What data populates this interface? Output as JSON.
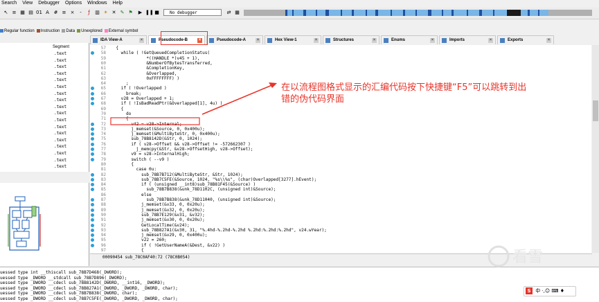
{
  "menu": [
    "Search",
    "View",
    "Debugger",
    "Options",
    "Windows",
    "Help"
  ],
  "toolbar": {
    "debugger_select": "No debugger"
  },
  "legend": [
    {
      "label": "Regular function",
      "color": "#3e7fcf"
    },
    {
      "label": "Instruction",
      "color": "#a0522d"
    },
    {
      "label": "Data",
      "color": "#a0a0a0"
    },
    {
      "label": "Unexplored",
      "color": "#7a9a3a"
    },
    {
      "label": "External symbol",
      "color": "#ff80c0"
    }
  ],
  "tabs": [
    "IDA View-A",
    "Pseudocode-B",
    "Pseudocode-A",
    "Hex View-1",
    "Structures",
    "Enums",
    "Imports",
    "Exports"
  ],
  "functions": {
    "segment_header": "Segment",
    "segments": [
      ".text",
      ".text",
      ".text",
      ".text",
      ".text",
      ".text",
      ".text",
      ".text",
      ".text",
      ".text",
      ".text",
      ".text",
      ".text",
      ".text",
      ".text",
      ".text",
      ".text",
      ".text"
    ]
  },
  "pseudocode": {
    "lines": [
      {
        "n": "57",
        "bp": false,
        "text": "  {"
      },
      {
        "n": "58",
        "bp": true,
        "text": "    while ( !GetQueuedCompletionStatus("
      },
      {
        "n": "59",
        "bp": false,
        "text": "              *((HANDLE *)v45 + 1),"
      },
      {
        "n": "60",
        "bp": false,
        "text": "              &NumberOfBytesTransferred,"
      },
      {
        "n": "61",
        "bp": false,
        "text": "              &CompletionKey,"
      },
      {
        "n": "62",
        "bp": false,
        "text": "              &Overlapped,"
      },
      {
        "n": "63",
        "bp": false,
        "text": "              0xFFFFFFFF) )"
      },
      {
        "n": "64",
        "bp": false,
        "text": "      ;"
      },
      {
        "n": "65",
        "bp": true,
        "text": "    if ( !Overlapped )"
      },
      {
        "n": "66",
        "bp": true,
        "text": "      break;"
      },
      {
        "n": "67",
        "bp": true,
        "text": "    v28 = Overlapped + 1;"
      },
      {
        "n": "68",
        "bp": true,
        "text": "    if ( !IsBadReadPtr(&Overlapped[1], 4u) )"
      },
      {
        "n": "69",
        "bp": false,
        "text": "    {"
      },
      {
        "n": "70",
        "bp": false,
        "text": "      do"
      },
      {
        "n": "71",
        "bp": false,
        "text": "      {"
      },
      {
        "n": "72",
        "bp": true,
        "text": "        v42 = v28->Internal;"
      },
      {
        "n": "73",
        "bp": true,
        "text": "        j_memset(&Source, 0, 0x400u);"
      },
      {
        "n": "74",
        "bp": true,
        "text": "        j_memset(&MultiByteStr, 0, 0x400u);"
      },
      {
        "n": "75",
        "bp": true,
        "text": "        sub_78B8142D(&Str, 0, 1024);"
      },
      {
        "n": "76",
        "bp": true,
        "text": "        if ( v28->Offset && v28->Offset != -572662307 )"
      },
      {
        "n": "77",
        "bp": true,
        "text": "          j_memcpy(&Str, &v28->OffsetHigh, v28->Offset);"
      },
      {
        "n": "78",
        "bp": true,
        "text": "        v9 = v28->InternalHigh;"
      },
      {
        "n": "79",
        "bp": true,
        "text": "        switch ( --v9 )"
      },
      {
        "n": "80",
        "bp": false,
        "text": "        {"
      },
      {
        "n": "81",
        "bp": false,
        "text": "          case 0u:"
      },
      {
        "n": "82",
        "bp": true,
        "text": "            sub_78B7B712(&MultiByteStr, &Str, 1024);"
      },
      {
        "n": "83",
        "bp": true,
        "text": "            sub_78B7C5FE(&Source, 1024, \"%s\\\\%s\", (char)Overlapped[3277].hEvent);"
      },
      {
        "n": "84",
        "bp": true,
        "text": "            if ( (unsigned __int8)sub_78B81F45(&Source) )"
      },
      {
        "n": "85",
        "bp": true,
        "text": "              sub_78B7B838(&unk_78D1102C, (unsigned int)&Source);"
      },
      {
        "n": "86",
        "bp": false,
        "text": "            else"
      },
      {
        "n": "87",
        "bp": true,
        "text": "              sub_78B7B838(&unk_78D11040, (unsigned int)&Source);"
      },
      {
        "n": "88",
        "bp": true,
        "text": "            j_memset(&v33, 0, 0x20u);"
      },
      {
        "n": "89",
        "bp": true,
        "text": "            j_memset(&v32, 0, 0x20u);"
      },
      {
        "n": "90",
        "bp": true,
        "text": "            sub_78B7E129(&v31, &v32);"
      },
      {
        "n": "91",
        "bp": true,
        "text": "            j_memset(&v30, 0, 0x20u);"
      },
      {
        "n": "92",
        "bp": true,
        "text": "            GetLocalTime(&v24);"
      },
      {
        "n": "93",
        "bp": true,
        "text": "            sub_78B827A1(&v30, 31, \"%.4hd-%.2hd-%.2hd %.2hd:%.2hd:%.2hd\", v24.wYear);"
      },
      {
        "n": "94",
        "bp": true,
        "text": "            j_memset(&v29, 0, 0x400u);"
      },
      {
        "n": "95",
        "bp": true,
        "text": "            v22 = 260;"
      },
      {
        "n": "96",
        "bp": true,
        "text": "            if ( !GetUserNameA(&Dest, &v22) )"
      },
      {
        "n": "97",
        "bp": false,
        "text": "            {"
      }
    ]
  },
  "status_line": "00090454 sub_78C0AF40:72 (78C0B054)",
  "output_lines": [
    "uessed type int __thiscall sub_78B7D468(_DWORD);",
    "uessed type _DWORD __stdcall sub_78B7D896(_DWORD);",
    "uessed type _DWORD __cdecl sub_78B8142D(_DWORD, __int16, _DWORD);",
    "uessed type _DWORD __cdecl sub_78B827A1(_DWORD, _DWORD, _DWORD, char);",
    "uessed type _DWORD __cdecl sub_78B7B838(_DWORD, char);",
    "uessed type _DWORD __cdecl sub_78B7C5FE(_DWORD, _DWORD, _DWORD, char);"
  ],
  "annotation": "在以流程图格式显示的汇编代码按下快捷键“F5”可以跳转到出错的伪代码界面",
  "colors": {
    "annotation": "#e8342a",
    "highlight_box": "#e8342a",
    "breakpoint": "#2c9fd8"
  }
}
